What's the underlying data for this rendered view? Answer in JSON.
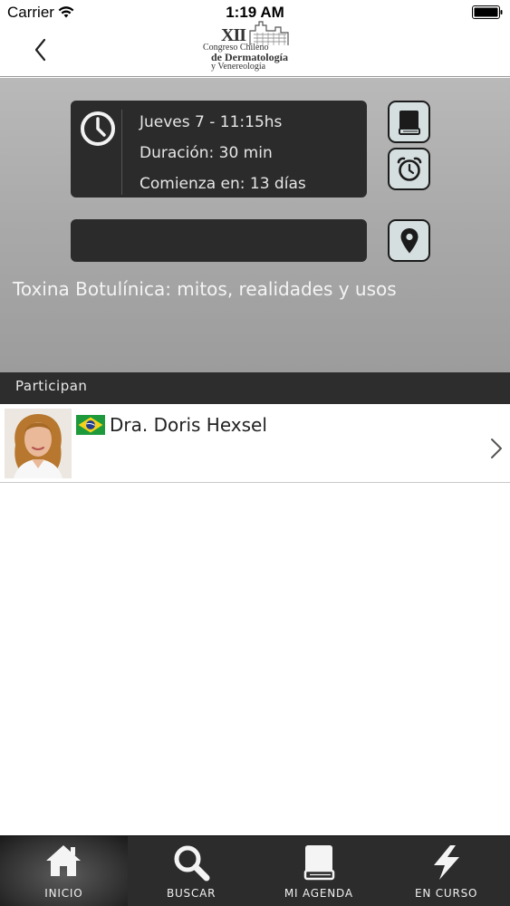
{
  "status_bar": {
    "carrier": "Carrier",
    "time": "1:19 AM",
    "icons": [
      "wifi-icon",
      "battery-icon"
    ]
  },
  "nav": {
    "back_icon": "chevron-left-icon",
    "logo": {
      "numeral": "XII",
      "line1": "Congreso Chileno",
      "line2": "de Dermatología",
      "line3": "y Venereología"
    }
  },
  "event": {
    "day_time": "Jueves 7 - 11:15hs",
    "duration": "Duración: 30 min",
    "starts_in": "Comienza en: 13 días",
    "location": "",
    "title": "Toxina Botulínica: mitos, realidades y usos",
    "actions": [
      "book-icon",
      "alarm-clock-icon",
      "location-pin-icon"
    ]
  },
  "participants": {
    "header": "Participan",
    "items": [
      {
        "name": "Dra. Doris Hexsel",
        "country_flag": "brazil-flag-icon"
      }
    ]
  },
  "tabs": [
    {
      "label": "INICIO",
      "icon": "home-icon",
      "active": true
    },
    {
      "label": "BUSCAR",
      "icon": "search-icon",
      "active": false
    },
    {
      "label": "MI AGENDA",
      "icon": "book-icon",
      "active": false
    },
    {
      "label": "EN CURSO",
      "icon": "lightning-icon",
      "active": false
    }
  ],
  "colors": {
    "panel_top": "#b9b9b9",
    "panel_bottom": "#9c9c9c",
    "dark_box": "#2b2b2b",
    "action_button": "#d5dfdf",
    "tab_bar": "#2c2c2c"
  }
}
